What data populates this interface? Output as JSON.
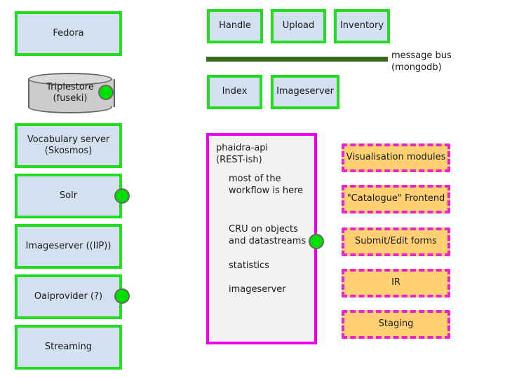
{
  "diagram": {
    "title": "Phaidra architecture overview",
    "colors": {
      "service_fill": "#d3e0ef",
      "service_border": "#22dd22",
      "frontend_fill": "#ffd173",
      "frontend_border": "#ee22cc",
      "api_border": "#ee00ee",
      "api_fill": "#f2f2f2",
      "bus_bar": "#3a6b21",
      "connector_dot": "#00e000",
      "cylinder_fill": "#cccccc"
    }
  },
  "backend_services": [
    {
      "label": "Fedora",
      "has_connector": false
    },
    {
      "label": "Vocabulary server\n(Skosmos)",
      "has_connector": false
    },
    {
      "label": "Solr",
      "has_connector": true
    },
    {
      "label": "Imageserver ((IIP))",
      "has_connector": false
    },
    {
      "label": "Oaiprovider (?)",
      "has_connector": true
    },
    {
      "label": "Streaming",
      "has_connector": false
    }
  ],
  "datastore": {
    "label": "Triplestore\n(fuseki)",
    "shape": "cylinder",
    "has_connector": true
  },
  "bus_services_top": [
    {
      "label": "Handle"
    },
    {
      "label": "Upload"
    },
    {
      "label": "Inventory"
    }
  ],
  "bus_services_bottom": [
    {
      "label": "Index"
    },
    {
      "label": "Imageserver"
    }
  ],
  "message_bus": {
    "label": "message bus\n(mongodb)"
  },
  "api": {
    "title": "phaidra-api\n (REST-ish)",
    "notes": [
      "most of the\nworkflow is here",
      "CRU on objects\nand datastreams",
      "statistics",
      "imageserver"
    ],
    "has_connector": true
  },
  "frontends": [
    {
      "label": "Visualisation modules"
    },
    {
      "label": "\"Catalogue\" Frontend"
    },
    {
      "label": "Submit/Edit forms"
    },
    {
      "label": "IR"
    },
    {
      "label": "Staging"
    }
  ]
}
